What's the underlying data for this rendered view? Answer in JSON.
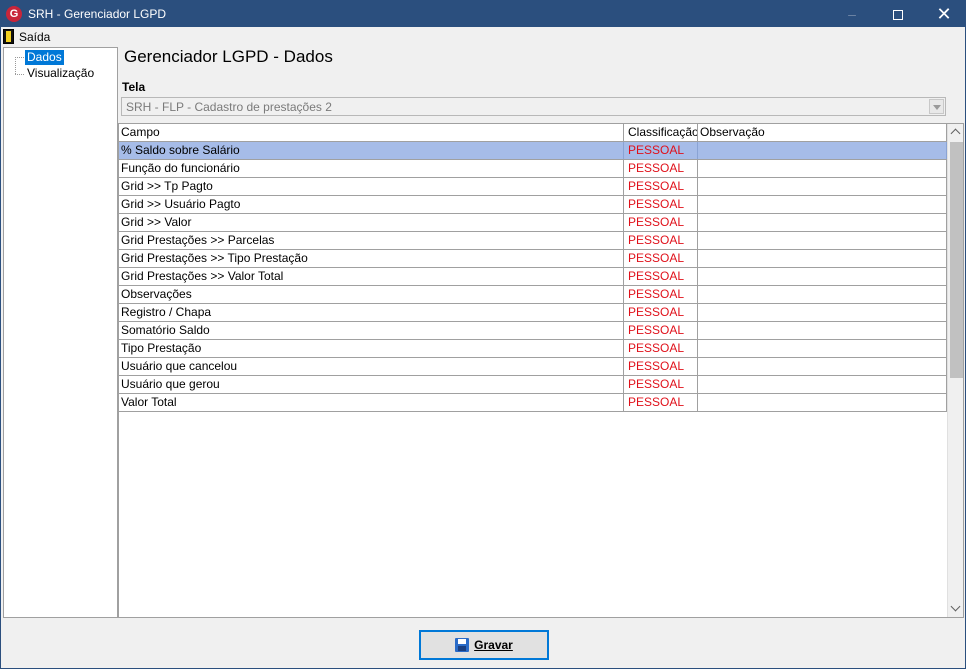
{
  "window": {
    "title": "SRH - Gerenciador LGPD",
    "app_icon": "srh-logo-icon",
    "controls": {
      "minimize": "–",
      "close": "✕"
    }
  },
  "menu": {
    "items": [
      {
        "label": "Saída",
        "icon": "door-exit-icon"
      }
    ]
  },
  "tree": {
    "items": [
      {
        "label": "Dados",
        "selected": true
      },
      {
        "label": "Visualização",
        "selected": false
      }
    ]
  },
  "page": {
    "title": "Gerenciador LGPD - Dados",
    "tela_label": "Tela",
    "tela_value": "SRH - FLP - Cadastro de prestações 2"
  },
  "grid": {
    "columns": [
      "Campo",
      "Classificação",
      "Observação"
    ],
    "rows": [
      {
        "campo": "% Saldo sobre Salário",
        "classificacao": "PESSOAL",
        "observacao": "",
        "selected": true
      },
      {
        "campo": "Função do funcionário",
        "classificacao": "PESSOAL",
        "observacao": ""
      },
      {
        "campo": "Grid >> Tp Pagto",
        "classificacao": "PESSOAL",
        "observacao": ""
      },
      {
        "campo": "Grid >> Usuário Pagto",
        "classificacao": "PESSOAL",
        "observacao": ""
      },
      {
        "campo": "Grid >> Valor",
        "classificacao": "PESSOAL",
        "observacao": ""
      },
      {
        "campo": "Grid Prestações >> Parcelas",
        "classificacao": "PESSOAL",
        "observacao": ""
      },
      {
        "campo": "Grid Prestações >> Tipo Prestação",
        "classificacao": "PESSOAL",
        "observacao": ""
      },
      {
        "campo": "Grid Prestações >> Valor Total",
        "classificacao": "PESSOAL",
        "observacao": ""
      },
      {
        "campo": "Observações",
        "classificacao": "PESSOAL",
        "observacao": ""
      },
      {
        "campo": "Registro / Chapa",
        "classificacao": "PESSOAL",
        "observacao": ""
      },
      {
        "campo": "Somatório Saldo",
        "classificacao": "PESSOAL",
        "observacao": ""
      },
      {
        "campo": "Tipo Prestação",
        "classificacao": "PESSOAL",
        "observacao": ""
      },
      {
        "campo": "Usuário que cancelou",
        "classificacao": "PESSOAL",
        "observacao": ""
      },
      {
        "campo": "Usuário que gerou",
        "classificacao": "PESSOAL",
        "observacao": ""
      },
      {
        "campo": "Valor Total",
        "classificacao": "PESSOAL",
        "observacao": ""
      }
    ]
  },
  "footer": {
    "save_button": {
      "label": "Gravar",
      "icon": "floppy-disk-icon"
    }
  },
  "colors": {
    "titlebar": "#2b4f7e",
    "selected_row": "#a6bce8",
    "classification_text": "#e0101a",
    "tree_selection": "#0078d7"
  }
}
